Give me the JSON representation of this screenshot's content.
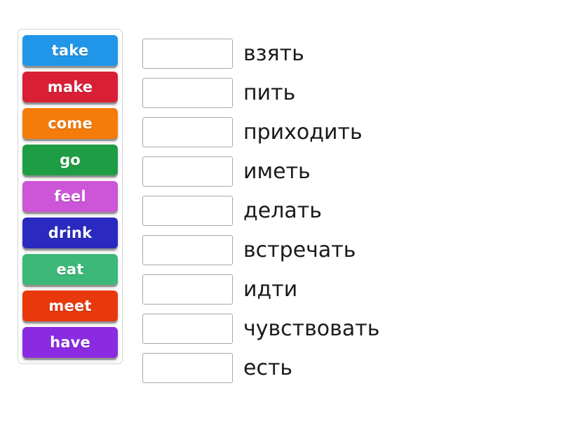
{
  "exercise": {
    "type": "drag-and-drop-matching",
    "tile_bank": {
      "label": "English verb tiles",
      "tiles": [
        {
          "label": "take",
          "color": "#2196e8"
        },
        {
          "label": "make",
          "color": "#d91f35"
        },
        {
          "label": "come",
          "color": "#f57c0a"
        },
        {
          "label": "go",
          "color": "#1f9d44"
        },
        {
          "label": "feel",
          "color": "#cc55d8"
        },
        {
          "label": "drink",
          "color": "#2a2ac0"
        },
        {
          "label": "eat",
          "color": "#3cb878"
        },
        {
          "label": "meet",
          "color": "#e8390c"
        },
        {
          "label": "have",
          "color": "#8a2be2"
        }
      ]
    },
    "rows": [
      {
        "answer": "",
        "translation": "взять"
      },
      {
        "answer": "",
        "translation": "пить"
      },
      {
        "answer": "",
        "translation": "приходить"
      },
      {
        "answer": "",
        "translation": "иметь"
      },
      {
        "answer": "",
        "translation": "делать"
      },
      {
        "answer": "",
        "translation": "встречать"
      },
      {
        "answer": "",
        "translation": "идти"
      },
      {
        "answer": "",
        "translation": "чувствовать"
      },
      {
        "answer": "",
        "translation": "есть"
      }
    ]
  }
}
